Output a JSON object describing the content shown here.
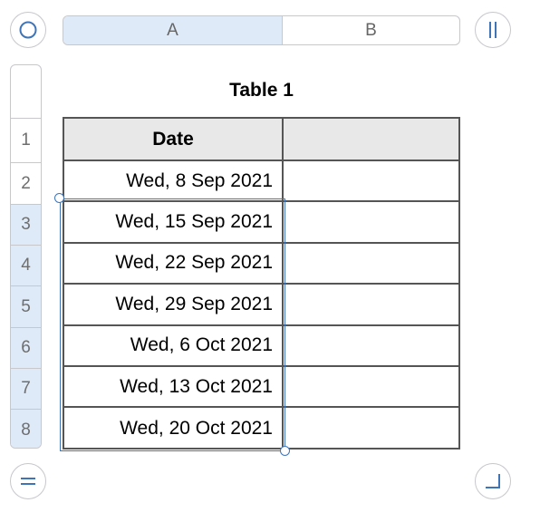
{
  "column_headers": [
    "A",
    "B"
  ],
  "row_headers": [
    "1",
    "2",
    "3",
    "4",
    "5",
    "6",
    "7",
    "8"
  ],
  "selected_rows": [
    "3",
    "4",
    "5",
    "6",
    "7",
    "8"
  ],
  "table": {
    "title": "Table 1",
    "header": [
      "Date",
      ""
    ],
    "rows": [
      [
        "Wed, 8 Sep 2021",
        ""
      ],
      [
        "Wed, 15 Sep 2021",
        ""
      ],
      [
        "Wed, 22 Sep 2021",
        ""
      ],
      [
        "Wed, 29 Sep 2021",
        ""
      ],
      [
        "Wed, 6 Oct 2021",
        ""
      ],
      [
        "Wed, 13 Oct 2021",
        ""
      ],
      [
        "Wed, 20 Oct 2021",
        ""
      ]
    ]
  },
  "icons": {
    "select_all": "circle-icon",
    "freeze_columns": "pause-bars-icon",
    "freeze_rows": "equals-icon",
    "resize": "corner-icon"
  },
  "colors": {
    "accent": "#3f75b8",
    "selected_header_bg": "#dfeaf8",
    "grid_border": "#555555",
    "header_row_bg": "#e8e8e8"
  }
}
